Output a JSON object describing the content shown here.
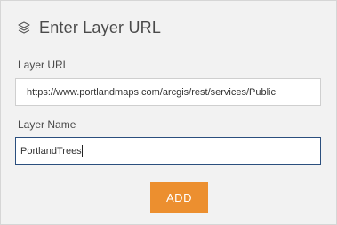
{
  "dialog": {
    "title": "Enter Layer URL",
    "icon": "layers-icon"
  },
  "form": {
    "url_label": "Layer URL",
    "url_value": "https://www.portlandmaps.com/arcgis/rest/services/Publiс",
    "name_label": "Layer Name",
    "name_value": "PortlandTrees"
  },
  "actions": {
    "add_label": "ADD"
  },
  "colors": {
    "panel_bg": "#f2f2f2",
    "accent_button": "#ec8f2f",
    "focus_border": "#2b4f7e"
  }
}
